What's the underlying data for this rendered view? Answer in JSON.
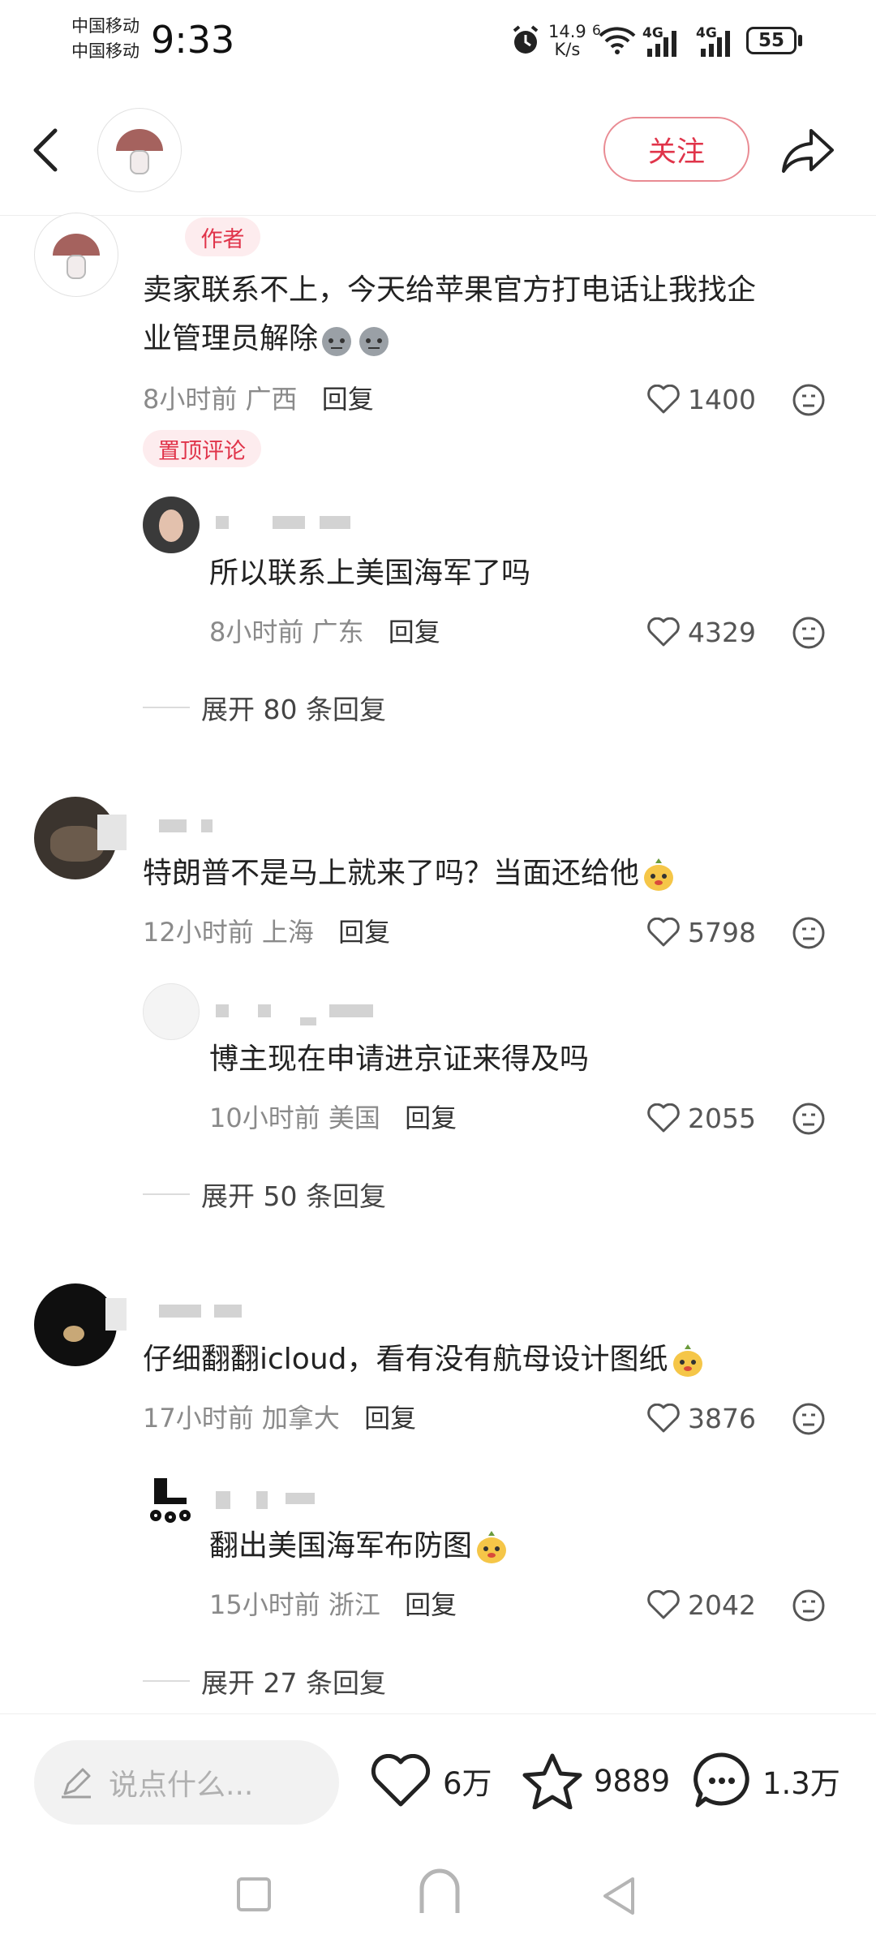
{
  "status_bar": {
    "carrier_1": "中国移动",
    "carrier_2": "中国移动",
    "time": "9:33",
    "net_speed_value": "14.9",
    "net_speed_unit": "K/s",
    "wifi_badge": "6",
    "signal_1": "4G",
    "signal_2": "4G",
    "battery": "55"
  },
  "header": {
    "follow_label": "关注"
  },
  "comments": [
    {
      "tag": "作者",
      "text_line1": "卖家联系不上，今天给苹果官方打电话让我找企",
      "text_line2": "业管理员解除",
      "time": "8小时前",
      "location": "广西",
      "reply_label": "回复",
      "likes": "1400",
      "pin_label": "置顶评论",
      "reply": {
        "text": "所以联系上美国海军了吗",
        "time": "8小时前",
        "location": "广东",
        "reply_label": "回复",
        "likes": "4329"
      },
      "expand": "展开 80 条回复"
    },
    {
      "text": "特朗普不是马上就来了吗？当面还给他",
      "time": "12小时前",
      "location": "上海",
      "reply_label": "回复",
      "likes": "5798",
      "reply": {
        "text": "博主现在申请进京证来得及吗",
        "time": "10小时前",
        "location": "美国",
        "reply_label": "回复",
        "likes": "2055"
      },
      "expand": "展开 50 条回复"
    },
    {
      "text": "仔细翻翻icloud，看有没有航母设计图纸",
      "time": "17小时前",
      "location": "加拿大",
      "reply_label": "回复",
      "likes": "3876",
      "reply": {
        "text": "翻出美国海军布防图",
        "time": "15小时前",
        "location": "浙江",
        "reply_label": "回复",
        "likes": "2042"
      },
      "expand": "展开 27 条回复"
    }
  ],
  "bottom_bar": {
    "input_placeholder": "说点什么...",
    "likes": "6万",
    "favorites": "9889",
    "comments": "1.3万"
  },
  "colors": {
    "accent": "#e0344a",
    "tag_bg": "#fdecee",
    "meta": "#8a8a8a"
  }
}
